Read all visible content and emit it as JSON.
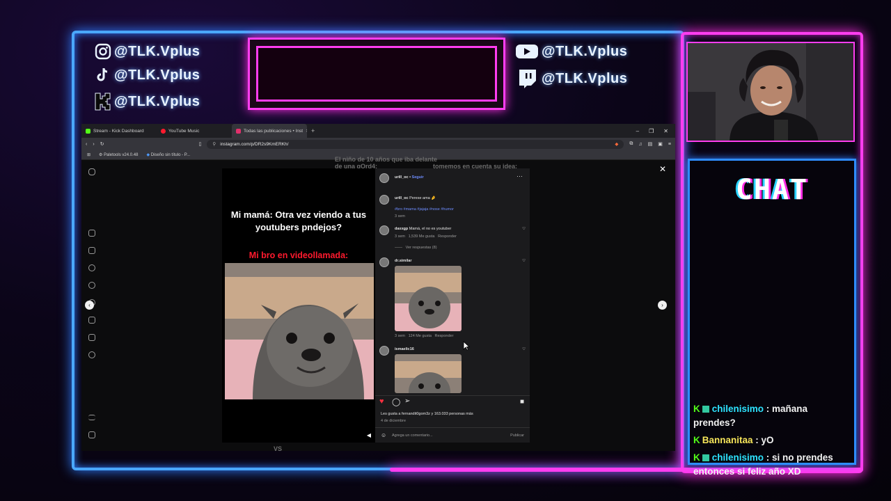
{
  "socials_left": [
    {
      "icon": "instagram-icon",
      "handle": "@TLK.Vplus"
    },
    {
      "icon": "tiktok-icon",
      "handle": "@TLK.Vplus"
    },
    {
      "icon": "kick-icon",
      "handle": "@TLK.Vplus"
    }
  ],
  "socials_right": [
    {
      "icon": "youtube-icon",
      "handle": "@TLK.Vplus"
    },
    {
      "icon": "twitch-icon",
      "handle": "@TLK.Vplus"
    }
  ],
  "browser": {
    "tabs": [
      {
        "label": "Stream - Kick Dashboard",
        "color": "#53fc18"
      },
      {
        "label": "YouTube Music",
        "color": "#ff1a2e"
      },
      {
        "label": "Todas las publicaciones • Inst",
        "color": "#e1306c"
      }
    ],
    "url": "instagram.com/p/DR2s9KmERKh/",
    "bookmarks": [
      "Paletools v24.0.48",
      "Diseño sin título - P..."
    ]
  },
  "background_text": {
    "left": "El niño de 10 años que iba delante de una gOrd4:",
    "right": "tomemos en cuenta su idea:",
    "bottom": "VS"
  },
  "post": {
    "meme_text": "Mi mamá: Otra vez viendo a tus youtubers pndejos?",
    "meme_red": "Mi bro en videollamada:",
    "author": "urill_oc",
    "follow": "Seguir",
    "caption_user": "urill_oc",
    "caption": "Perese ama 🤌",
    "hashtags": "#bro #mama #jajaja #nose #humor",
    "caption_time": "3 sem",
    "comments": [
      {
        "user": "daxxgp",
        "text": "Mamá, el no es youtuber",
        "time": "3 sem",
        "likes": "1,539 Me gusta",
        "reply": "Responder",
        "view_replies": "Ver respuestas (8)"
      },
      {
        "user": "dr.similar",
        "text": "",
        "time": "3 sem",
        "likes": "124 Me gusta",
        "reply": "Responder"
      },
      {
        "user": "ismaelic16",
        "text": ""
      }
    ],
    "liked_by": "Les gusta a fernandit0gom3z y 163.033 personas más",
    "date": "4 de diciembre",
    "comment_placeholder": "Agrega un comentario...",
    "publish": "Publicar"
  },
  "chat": {
    "title": "CHAT",
    "messages": [
      {
        "user": "chilenisimo",
        "text": " : mañana prendes?",
        "user_color": "#2de3ff",
        "badge2": true
      },
      {
        "user": "Bannanitaa",
        "text": " : yO",
        "user_color": "#f7e65a",
        "badge2": false
      },
      {
        "user": "chilenisimo",
        "text": " : si no prendes entonces si feliz año XD",
        "user_color": "#2de3ff",
        "badge2": true
      }
    ]
  }
}
